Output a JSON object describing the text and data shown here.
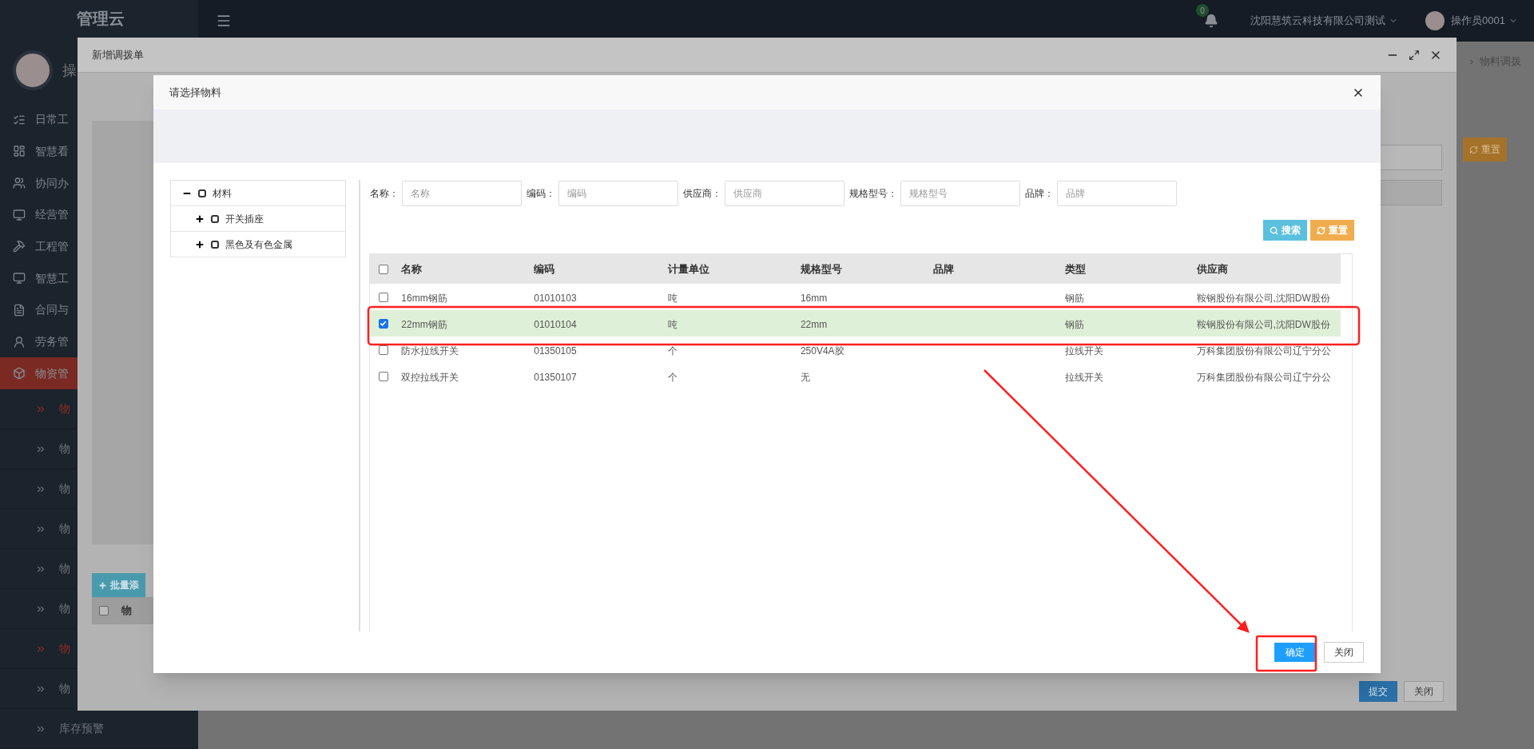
{
  "app": {
    "logo": "管理云",
    "notifications": {
      "count": "0"
    },
    "company": "沈阳慧筑云科技有限公司测试",
    "user": "操作员0001",
    "breadcrumb_separator": "›",
    "breadcrumb": "物料调拨",
    "reset_button": "重置"
  },
  "sidebar": {
    "user_name": "操",
    "items": [
      {
        "label": "日常工",
        "selected": false
      },
      {
        "label": "智慧看",
        "selected": false
      },
      {
        "label": "协同办",
        "selected": false
      },
      {
        "label": "经营管",
        "selected": false
      },
      {
        "label": "工程管",
        "selected": false
      },
      {
        "label": "智慧工",
        "selected": false
      },
      {
        "label": "合同与",
        "selected": false
      },
      {
        "label": "劳务管",
        "selected": false
      },
      {
        "label": "物资管",
        "selected": true,
        "children": [
          {
            "label": "物",
            "selected": true
          },
          {
            "label": "物",
            "selected": false
          },
          {
            "label": "物",
            "selected": false
          },
          {
            "label": "物",
            "selected": false
          },
          {
            "label": "物",
            "selected": false
          },
          {
            "label": "物",
            "selected": false
          },
          {
            "label": "物",
            "selected": true
          },
          {
            "label": "物",
            "selected": false
          },
          {
            "label": "库存预警",
            "selected": false
          }
        ]
      }
    ]
  },
  "outer_dialog": {
    "title": "新增调拨单",
    "batch_button": "批量添",
    "table_header": "物",
    "select_all_checked": false,
    "submit_button": "提交",
    "close_button": "关闭"
  },
  "dialog": {
    "title": "请选择物料",
    "tree": [
      {
        "label": "材料",
        "expanded": true,
        "checked": false,
        "children": [
          {
            "label": "开关插座",
            "expanded": false,
            "checked": false
          },
          {
            "label": "黑色及有色金属",
            "expanded": false,
            "checked": false
          }
        ]
      }
    ],
    "filters": [
      {
        "label": "名称：",
        "placeholder": "名称"
      },
      {
        "label": "编码：",
        "placeholder": "编码"
      },
      {
        "label": "供应商：",
        "placeholder": "供应商"
      },
      {
        "label": "规格型号：",
        "placeholder": "规格型号"
      },
      {
        "label": "品牌：",
        "placeholder": "品牌"
      }
    ],
    "search_button": "搜索",
    "reset_button": "重置",
    "table": {
      "select_all_checked": false,
      "columns": [
        "名称",
        "编码",
        "计量单位",
        "规格型号",
        "品牌",
        "类型",
        "供应商"
      ],
      "rows": [
        {
          "selected": false,
          "cells": [
            "16mm钢筋",
            "01010103",
            "吨",
            "16mm",
            "",
            "钢筋",
            "鞍钢股份有限公司,沈阳DW股份"
          ]
        },
        {
          "selected": true,
          "cells": [
            "22mm钢筋",
            "01010104",
            "吨",
            "22mm",
            "",
            "钢筋",
            "鞍钢股份有限公司,沈阳DW股份"
          ]
        },
        {
          "selected": false,
          "cells": [
            "防水拉线开关",
            "01350105",
            "个",
            "250V4A胶",
            "",
            "拉线开关",
            "万科集团股份有限公司辽宁分公"
          ]
        },
        {
          "selected": false,
          "cells": [
            "双控拉线开关",
            "01350107",
            "个",
            "无",
            "",
            "拉线开关",
            "万科集团股份有限公司辽宁分公"
          ]
        }
      ]
    },
    "confirm_button": "确定",
    "close_button": "关闭"
  }
}
